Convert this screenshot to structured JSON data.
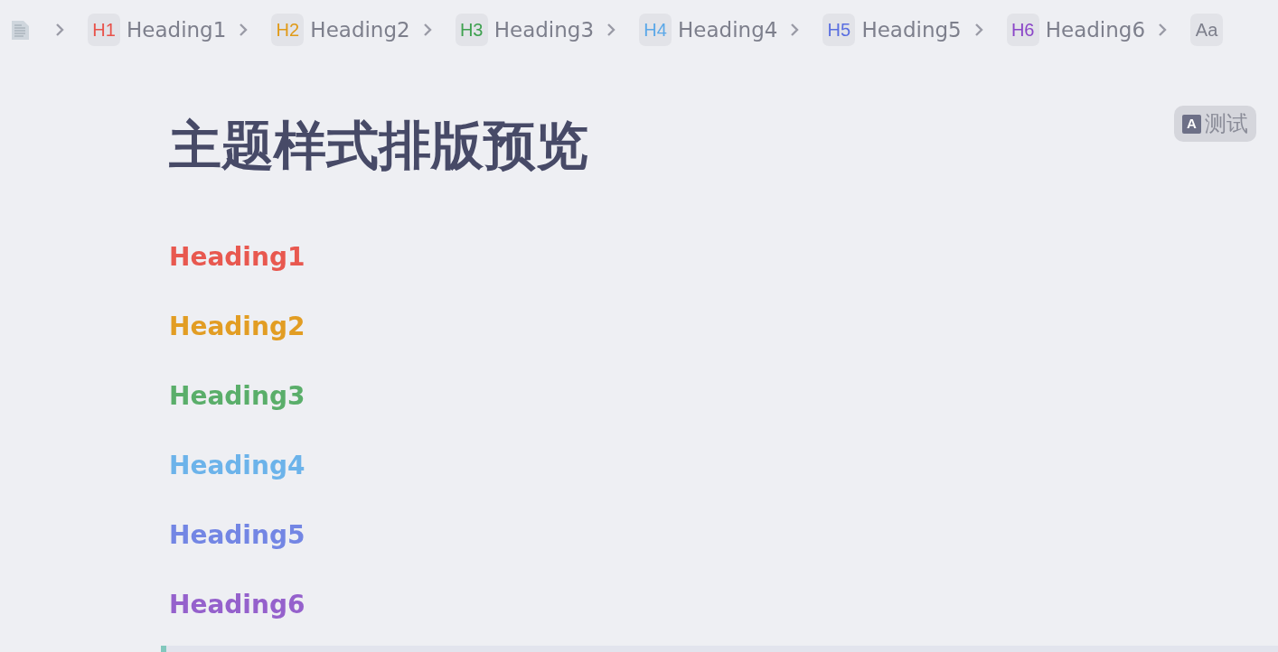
{
  "breadcrumb": [
    {
      "badge": "H1",
      "label": "Heading1",
      "color": "#e8524a"
    },
    {
      "badge": "H2",
      "label": "Heading2",
      "color": "#e09a18"
    },
    {
      "badge": "H3",
      "label": "Heading3",
      "color": "#3fa150"
    },
    {
      "badge": "H4",
      "label": "Heading4",
      "color": "#5ba8e8"
    },
    {
      "badge": "H5",
      "label": "Heading5",
      "color": "#5a6fe0"
    },
    {
      "badge": "H6",
      "label": "Heading6",
      "color": "#8b46c8"
    },
    {
      "badge": "Aa",
      "color": "#7d7f8c"
    }
  ],
  "title": "主题样式排版预览",
  "tag": {
    "letter": "A",
    "text": "测试"
  },
  "headings": [
    {
      "text": "Heading1",
      "color": "#e8584f"
    },
    {
      "text": "Heading2",
      "color": "#e29d23"
    },
    {
      "text": "Heading3",
      "color": "#5aae6a"
    },
    {
      "text": "Heading4",
      "color": "#6cb3ea"
    },
    {
      "text": "Heading5",
      "color": "#7386e4"
    },
    {
      "text": "Heading6",
      "color": "#9561cc"
    }
  ]
}
